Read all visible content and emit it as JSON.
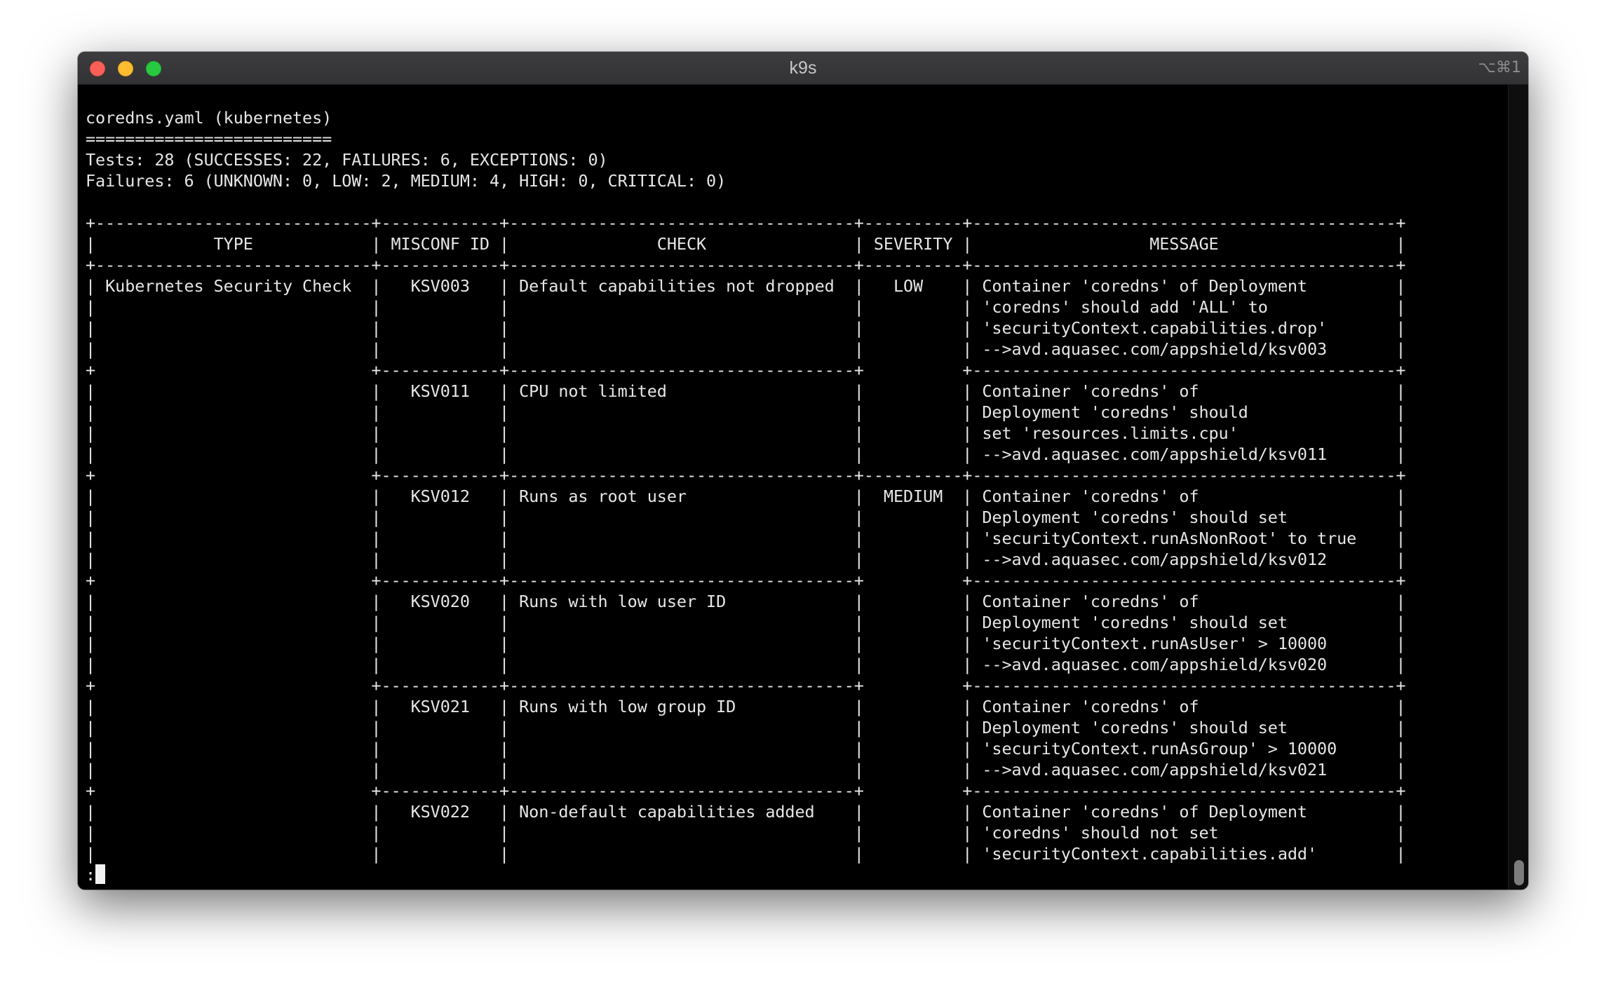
{
  "window": {
    "title": "k9s",
    "shortcut": "⌥⌘1"
  },
  "terminal": {
    "lines": [
      "coredns.yaml (kubernetes)",
      "=========================",
      "Tests: 28 (SUCCESSES: 22, FAILURES: 6, EXCEPTIONS: 0)",
      "Failures: 6 (UNKNOWN: 0, LOW: 2, MEDIUM: 4, HIGH: 0, CRITICAL: 0)",
      "",
      "+----------------------------+------------+-----------------------------------+----------+-------------------------------------------+",
      "|            TYPE            | MISCONF ID |               CHECK               | SEVERITY |                  MESSAGE                  |",
      "+----------------------------+------------+-----------------------------------+----------+-------------------------------------------+",
      "| Kubernetes Security Check  |   KSV003   | Default capabilities not dropped  |   LOW    | Container 'coredns' of Deployment         |",
      "|                            |            |                                   |          | 'coredns' should add 'ALL' to             |",
      "|                            |            |                                   |          | 'securityContext.capabilities.drop'       |",
      "|                            |            |                                   |          | -->avd.aquasec.com/appshield/ksv003       |",
      "+                            +------------+-----------------------------------+          +-------------------------------------------+",
      "|                            |   KSV011   | CPU not limited                   |          | Container 'coredns' of                    |",
      "|                            |            |                                   |          | Deployment 'coredns' should               |",
      "|                            |            |                                   |          | set 'resources.limits.cpu'                |",
      "|                            |            |                                   |          | -->avd.aquasec.com/appshield/ksv011       |",
      "+                            +------------+-----------------------------------+----------+-------------------------------------------+",
      "|                            |   KSV012   | Runs as root user                 |  MEDIUM  | Container 'coredns' of                    |",
      "|                            |            |                                   |          | Deployment 'coredns' should set           |",
      "|                            |            |                                   |          | 'securityContext.runAsNonRoot' to true    |",
      "|                            |            |                                   |          | -->avd.aquasec.com/appshield/ksv012       |",
      "+                            +------------+-----------------------------------+          +-------------------------------------------+",
      "|                            |   KSV020   | Runs with low user ID             |          | Container 'coredns' of                    |",
      "|                            |            |                                   |          | Deployment 'coredns' should set           |",
      "|                            |            |                                   |          | 'securityContext.runAsUser' > 10000       |",
      "|                            |            |                                   |          | -->avd.aquasec.com/appshield/ksv020       |",
      "+                            +------------+-----------------------------------+          +-------------------------------------------+",
      "|                            |   KSV021   | Runs with low group ID            |          | Container 'coredns' of                    |",
      "|                            |            |                                   |          | Deployment 'coredns' should set           |",
      "|                            |            |                                   |          | 'securityContext.runAsGroup' > 10000      |",
      "|                            |            |                                   |          | -->avd.aquasec.com/appshield/ksv021       |",
      "+                            +------------+-----------------------------------+          +-------------------------------------------+",
      "|                            |   KSV022   | Non-default capabilities added    |          | Container 'coredns' of Deployment         |",
      "|                            |            |                                   |          | 'coredns' should not set                  |",
      "|                            |            |                                   |          | 'securityContext.capabilities.add'        |"
    ],
    "prompt": ":"
  }
}
